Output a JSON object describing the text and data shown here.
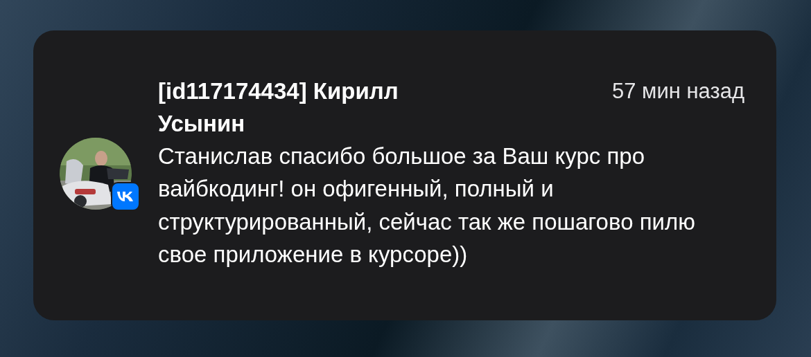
{
  "notification": {
    "sender": "[id117174434] Кирилл Усынин",
    "time": "57 мин назад",
    "message": "Станислав спасибо большое за Ваш курс про вайбкодинг! он офигенный, полный и структурированный, сейчас так же пошагово пилю свое приложение в курсоре))"
  }
}
